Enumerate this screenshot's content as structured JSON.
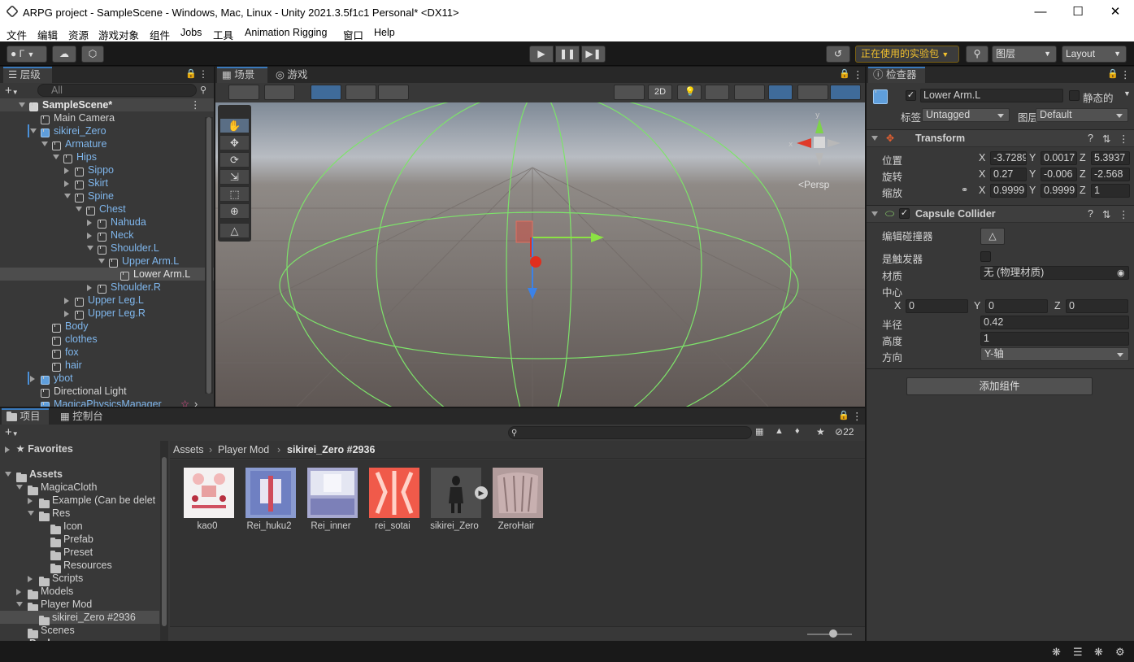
{
  "window": {
    "title": "ARPG project - SampleScene - Windows, Mac, Linux - Unity 2021.3.5f1c1 Personal* <DX11>"
  },
  "menu": [
    "文件",
    "编辑",
    "资源",
    "游戏对象",
    "组件",
    "Jobs",
    "工具",
    "Animation Rigging",
    "窗口",
    "Help"
  ],
  "toolbar": {
    "account": "Г",
    "experimental": "正在使用的实验包",
    "layers": "图层",
    "layout": "Layout"
  },
  "hierarchy": {
    "tab": "层级",
    "search_placeholder": "All",
    "items": [
      {
        "label": "SampleScene*",
        "indent": 0,
        "type": "scene",
        "arrow": "down"
      },
      {
        "label": "Main Camera",
        "indent": 1,
        "type": "obj",
        "arrow": ""
      },
      {
        "label": "sikirei_Zero",
        "indent": 1,
        "type": "prefab",
        "arrow": "down"
      },
      {
        "label": "Armature",
        "indent": 2,
        "type": "pobj",
        "arrow": "down"
      },
      {
        "label": "Hips",
        "indent": 3,
        "type": "pobj",
        "arrow": "down"
      },
      {
        "label": "Sippo",
        "indent": 4,
        "type": "pobj",
        "arrow": "right"
      },
      {
        "label": "Skirt",
        "indent": 4,
        "type": "pobj",
        "arrow": "right"
      },
      {
        "label": "Spine",
        "indent": 4,
        "type": "pobj",
        "arrow": "down"
      },
      {
        "label": "Chest",
        "indent": 5,
        "type": "pobj",
        "arrow": "down"
      },
      {
        "label": "Nahuda",
        "indent": 6,
        "type": "pobj",
        "arrow": "right"
      },
      {
        "label": "Neck",
        "indent": 6,
        "type": "pobj",
        "arrow": "right"
      },
      {
        "label": "Shoulder.L",
        "indent": 6,
        "type": "pobj",
        "arrow": "down"
      },
      {
        "label": "Upper Arm.L",
        "indent": 7,
        "type": "pobj",
        "arrow": "down"
      },
      {
        "label": "Lower Arm.L",
        "indent": 8,
        "type": "sel",
        "arrow": ""
      },
      {
        "label": "Shoulder.R",
        "indent": 6,
        "type": "pobj",
        "arrow": "right"
      },
      {
        "label": "Upper Leg.L",
        "indent": 4,
        "type": "pobj",
        "arrow": "right"
      },
      {
        "label": "Upper Leg.R",
        "indent": 4,
        "type": "pobj",
        "arrow": "right"
      },
      {
        "label": "Body",
        "indent": 2,
        "type": "pobj",
        "arrow": ""
      },
      {
        "label": "clothes",
        "indent": 2,
        "type": "pobj",
        "arrow": ""
      },
      {
        "label": "fox",
        "indent": 2,
        "type": "pobj",
        "arrow": ""
      },
      {
        "label": "hair",
        "indent": 2,
        "type": "pobj",
        "arrow": ""
      },
      {
        "label": "ybot",
        "indent": 1,
        "type": "prefab",
        "arrow": "right"
      },
      {
        "label": "Directional Light",
        "indent": 1,
        "type": "obj",
        "arrow": ""
      },
      {
        "label": "MagicaPhysicsManager",
        "indent": 1,
        "type": "prefab",
        "arrow": ""
      }
    ]
  },
  "scene": {
    "tab_scene": "场景",
    "tab_game": "游戏",
    "btn_2d": "2D",
    "persp": "<Persp"
  },
  "inspector": {
    "tab": "检查器",
    "object_name": "Lower Arm.L",
    "static_label": "静态的",
    "tag_label": "标签",
    "tag_value": "Untagged",
    "layer_label": "图层",
    "layer_value": "Default",
    "transform": {
      "title": "Transform",
      "position_label": "位置",
      "rotation_label": "旋转",
      "scale_label": "缩放",
      "position": [
        "-3.7289",
        "0.0017",
        "5.3937"
      ],
      "rotation": [
        "0.27",
        "-0.006",
        "-2.568"
      ],
      "scale": [
        "0.9999",
        "0.9999",
        "1"
      ]
    },
    "collider": {
      "title": "Capsule Collider",
      "edit_label": "编辑碰撞器",
      "trigger_label": "是触发器",
      "material_label": "材质",
      "material_value": "无 (物理材质)",
      "center_label": "中心",
      "center": [
        "0",
        "0",
        "0"
      ],
      "radius_label": "半径",
      "radius": "0.42",
      "height_label": "高度",
      "height": "1",
      "direction_label": "方向",
      "direction": "Y-轴"
    },
    "add_component": "添加组件",
    "axes": [
      "X",
      "Y",
      "Z"
    ]
  },
  "project": {
    "tab_project": "项目",
    "tab_console": "控制台",
    "hidden_count": "22",
    "favorites": "Favorites",
    "tree": [
      {
        "label": "Assets",
        "indent": 0,
        "arrow": "down",
        "bold": true
      },
      {
        "label": "MagicaCloth",
        "indent": 1,
        "arrow": "down"
      },
      {
        "label": "Example (Can be delet",
        "indent": 2,
        "arrow": "right"
      },
      {
        "label": "Res",
        "indent": 2,
        "arrow": "down"
      },
      {
        "label": "Icon",
        "indent": 3,
        "arrow": ""
      },
      {
        "label": "Prefab",
        "indent": 3,
        "arrow": ""
      },
      {
        "label": "Preset",
        "indent": 3,
        "arrow": ""
      },
      {
        "label": "Resources",
        "indent": 3,
        "arrow": ""
      },
      {
        "label": "Scripts",
        "indent": 2,
        "arrow": "right"
      },
      {
        "label": "Models",
        "indent": 1,
        "arrow": "right"
      },
      {
        "label": "Player Mod",
        "indent": 1,
        "arrow": "down"
      },
      {
        "label": "sikirei_Zero #2936",
        "indent": 2,
        "arrow": "",
        "selected": true
      },
      {
        "label": "Scenes",
        "indent": 1,
        "arrow": ""
      },
      {
        "label": "Packages",
        "indent": 0,
        "arrow": "right",
        "bold": true
      }
    ],
    "breadcrumb": [
      "Assets",
      "Player Mod",
      "sikirei_Zero #2936"
    ],
    "assets": [
      "kao0",
      "Rei_huku2",
      "Rei_inner",
      "rei_sotai",
      "sikirei_Zero",
      "ZeroHair"
    ]
  }
}
